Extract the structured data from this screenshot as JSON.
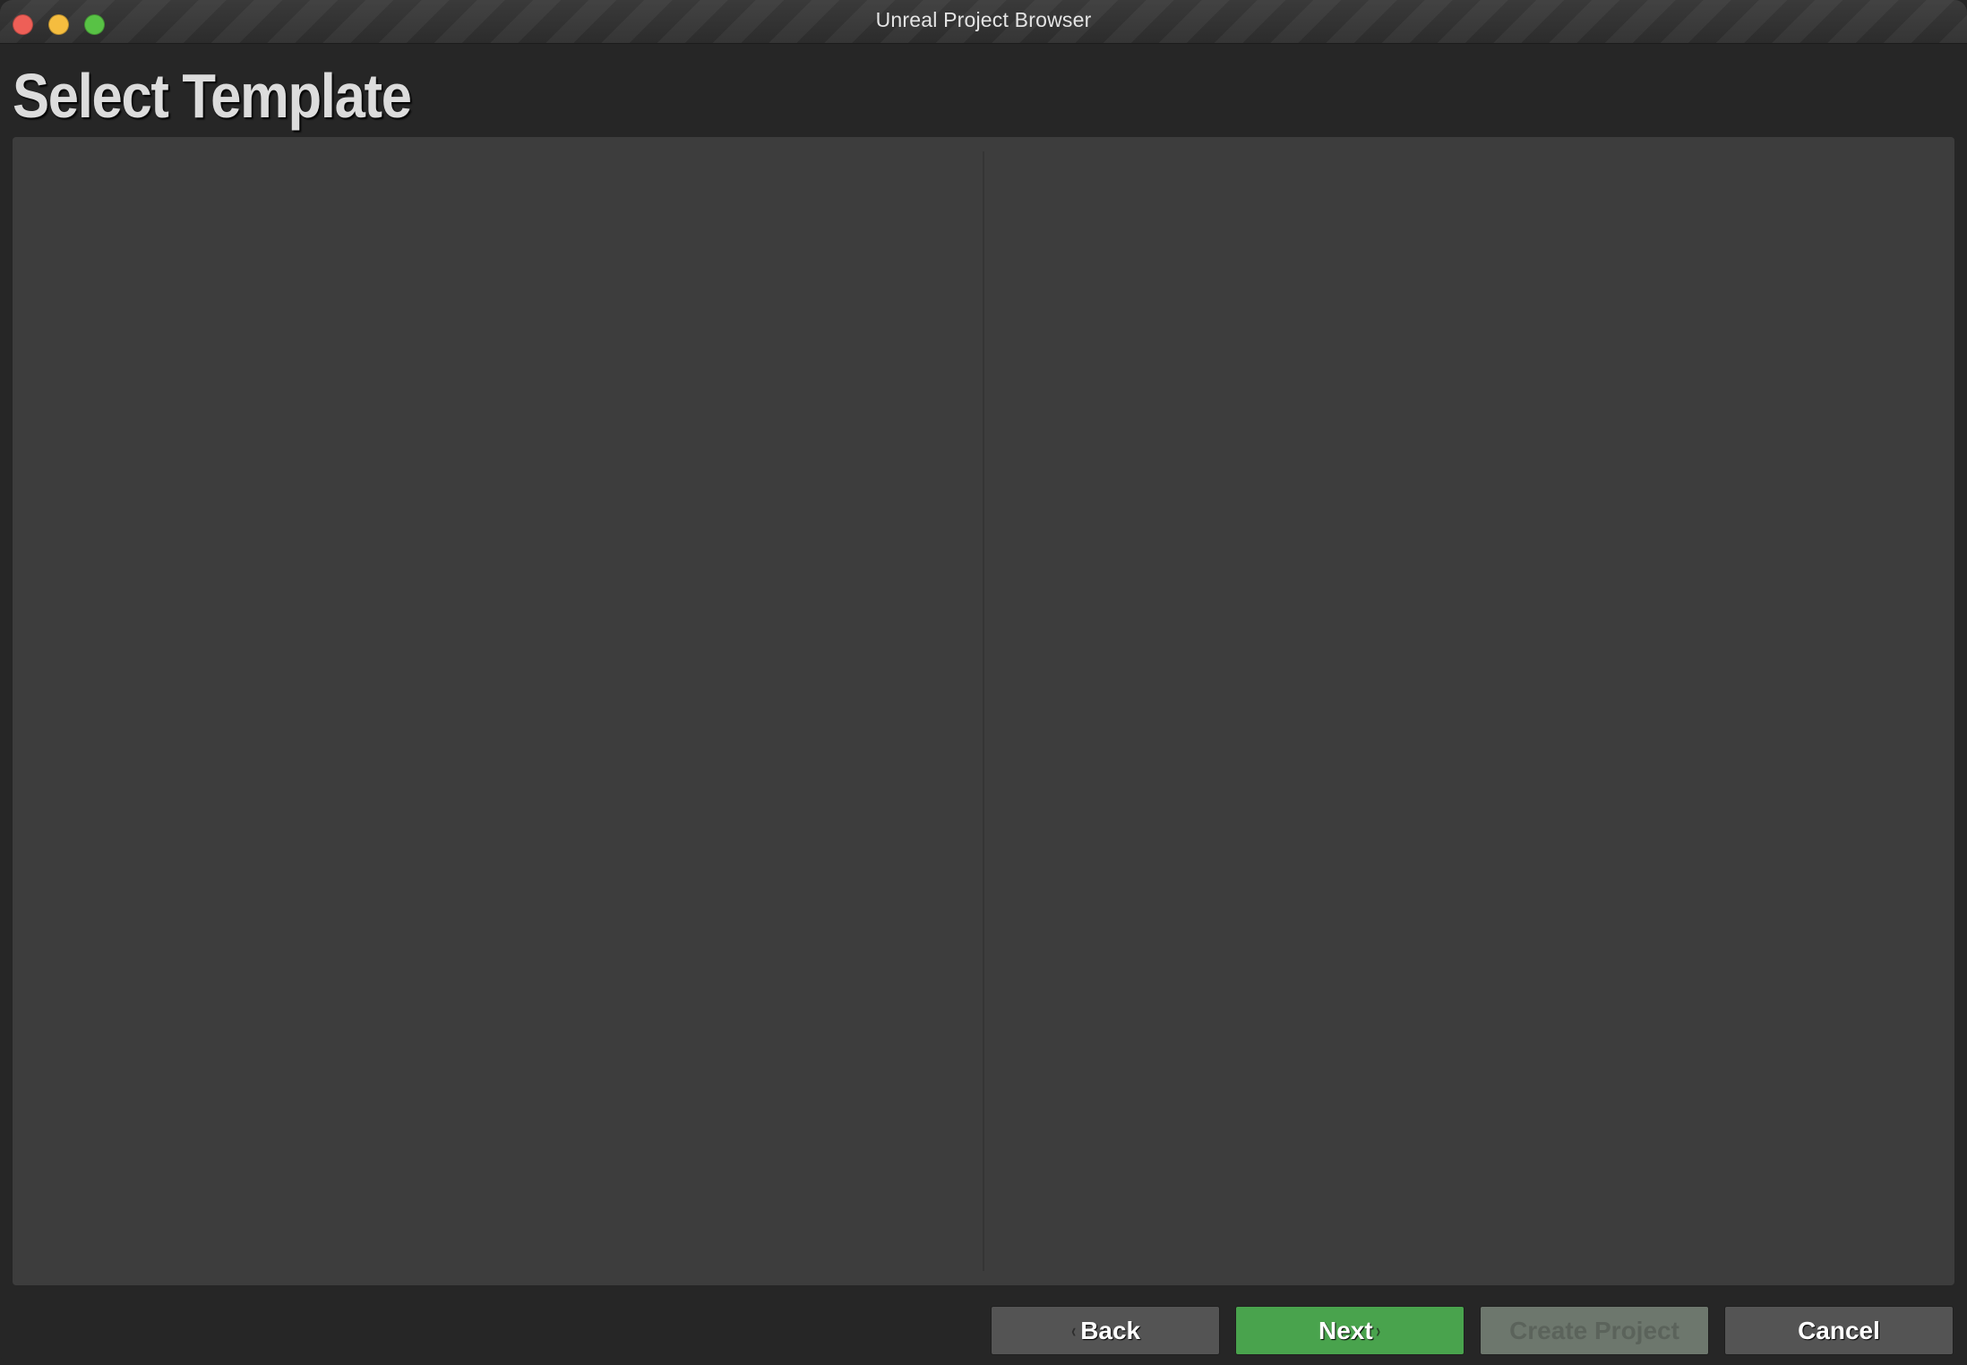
{
  "window": {
    "title": "Unreal Project Browser"
  },
  "traffic_lights": {
    "close_color": "#ee5f57",
    "minimize_color": "#f5bd3f",
    "maximize_color": "#58c245"
  },
  "page": {
    "title": "Select Template"
  },
  "buttons": {
    "back_label": "Back",
    "next_label": "Next",
    "create_project_label": "Create Project",
    "create_project_enabled": false,
    "cancel_label": "Cancel"
  },
  "icons": {
    "back": "chevron-left-icon",
    "next": "chevron-right-icon",
    "back_glyph": "‹",
    "next_glyph": "›"
  },
  "colors": {
    "background": "#262626",
    "panel": "#3d3d3d",
    "accent_green": "#49a34d",
    "button_gray": "#545454"
  }
}
